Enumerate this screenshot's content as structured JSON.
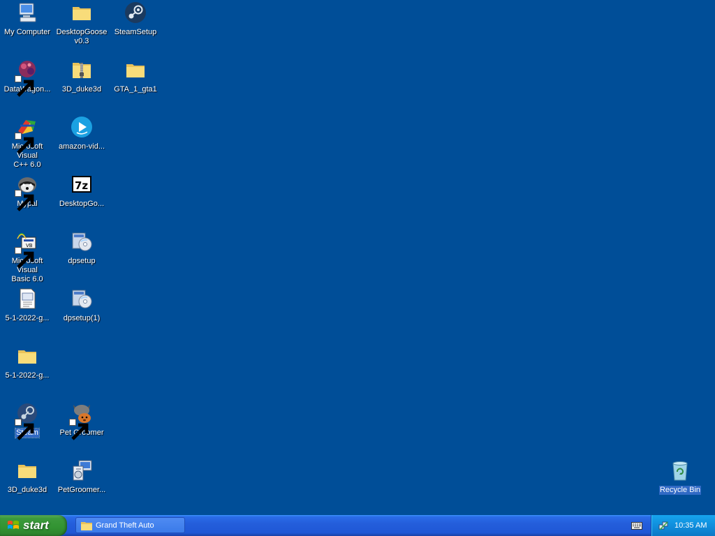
{
  "desktop": {
    "icons": [
      {
        "label": "My Computer",
        "icon": "my-computer-icon"
      },
      {
        "label": "DesktopGoose\nv0.3",
        "icon": "folder-icon"
      },
      {
        "label": "SteamSetup",
        "icon": "steam-setup-icon"
      },
      {
        "label": "DataWagon...",
        "icon": "datawagon-icon"
      },
      {
        "label": "3D_duke3d",
        "icon": "zip-folder-icon"
      },
      {
        "label": "GTA_1_gta1",
        "icon": "folder-icon"
      },
      {
        "label": "Microsoft Visual\nC++ 6.0",
        "icon": "visual-cpp-icon"
      },
      {
        "label": "amazon-vid...",
        "icon": "amazon-video-icon"
      },
      {
        "label": "Mypal",
        "icon": "mypal-icon"
      },
      {
        "label": "DesktopGo...",
        "icon": "7zip-archive-icon"
      },
      {
        "label": "Microsoft Visual\nBasic 6.0",
        "icon": "visual-basic-icon"
      },
      {
        "label": "dpsetup",
        "icon": "setup-disc-icon"
      },
      {
        "label": "5-1-2022-g...",
        "icon": "text-file-icon"
      },
      {
        "label": "dpsetup(1)",
        "icon": "setup-disc-icon"
      },
      {
        "label": "5-1-2022-g...",
        "icon": "folder-icon"
      },
      {
        "label": "Steam",
        "icon": "steam-icon"
      },
      {
        "label": "Pet Groomer",
        "icon": "pet-groomer-icon"
      },
      {
        "label": "3D_duke3d",
        "icon": "folder-icon"
      },
      {
        "label": "PetGroomer...",
        "icon": "installer-icon"
      },
      {
        "label": "Recycle Bin",
        "icon": "recycle-bin-icon"
      }
    ]
  },
  "taskbar": {
    "start_label": "start",
    "tasks": [
      {
        "label": "Grand Theft Auto",
        "icon": "folder-icon"
      }
    ],
    "clock": "10:35 AM"
  },
  "colors": {
    "desktop_background": "#004e98",
    "taskbar_blue": "#245edb",
    "start_green": "#329332",
    "tray_blue": "#0f8ad9",
    "selection": "#316ac5"
  }
}
